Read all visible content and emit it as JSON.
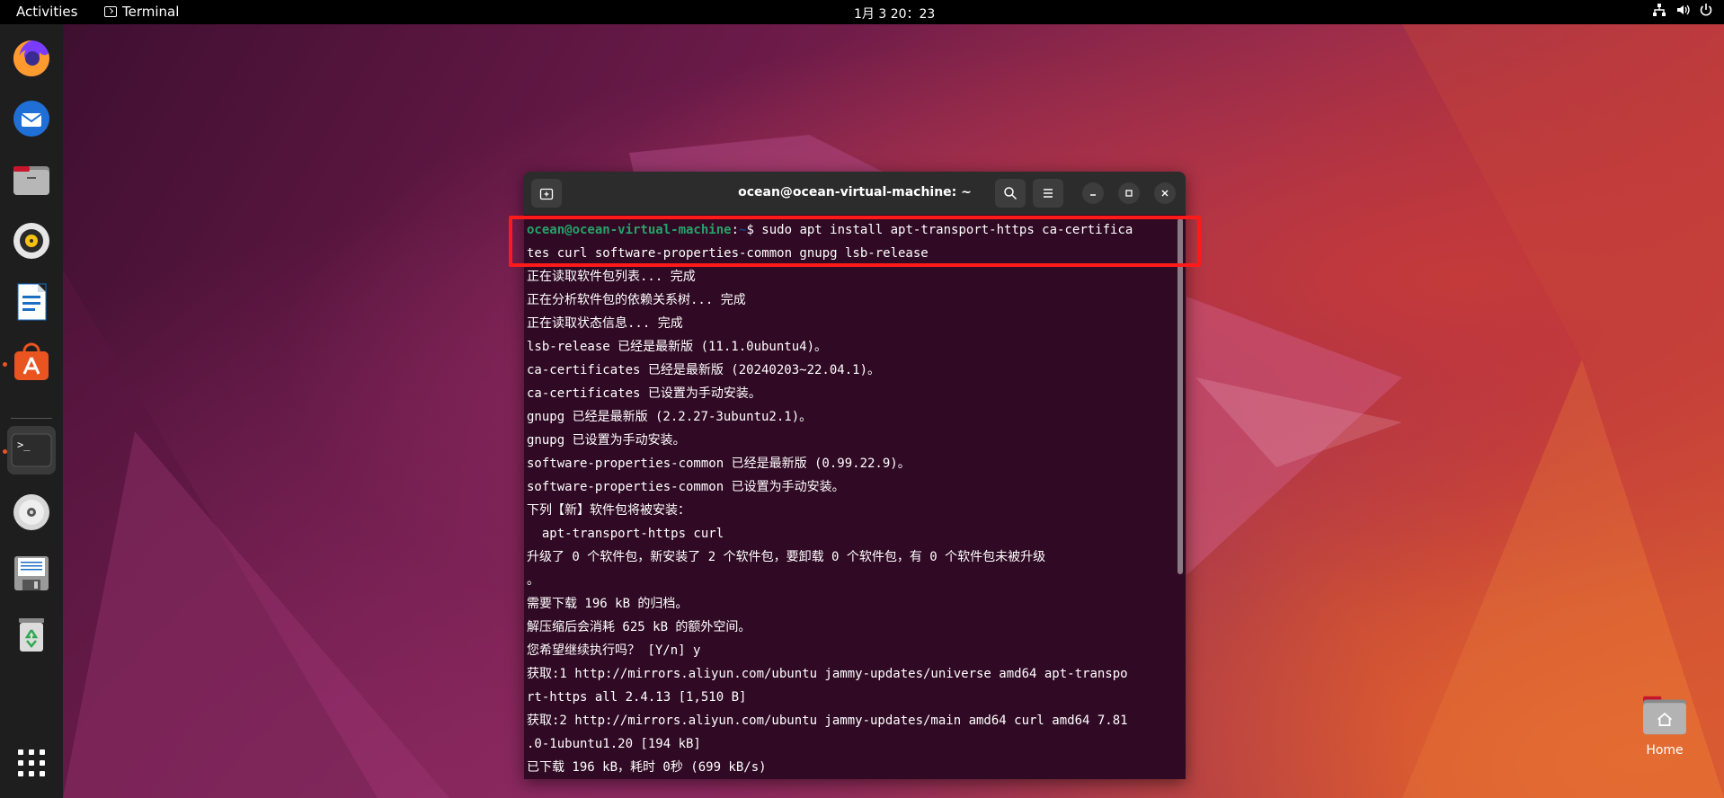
{
  "topbar": {
    "activities": "Activities",
    "app_name": "Terminal",
    "clock": "1月 3  20：23"
  },
  "dock": {
    "items": [
      {
        "name": "firefox-icon"
      },
      {
        "name": "thunderbird-icon"
      },
      {
        "name": "files-icon"
      },
      {
        "name": "rhythmbox-icon"
      },
      {
        "name": "libreoffice-writer-icon"
      },
      {
        "name": "app-center-icon"
      },
      {
        "name": "terminal-icon"
      },
      {
        "name": "disc-icon"
      },
      {
        "name": "floppy-save-icon"
      },
      {
        "name": "trash-icon"
      },
      {
        "name": "show-apps-icon"
      }
    ]
  },
  "terminal": {
    "title": "ocean@ocean-virtual-machine: ~",
    "prompt_user": "ocean@ocean-virtual-machine",
    "prompt_sep": ":",
    "prompt_path": "~",
    "prompt_cmd": "$ sudo apt install apt-transport-https ca-certifica",
    "lines": [
      "tes curl software-properties-common gnupg lsb-release",
      "正在读取软件包列表... 完成",
      "正在分析软件包的依赖关系树... 完成",
      "正在读取状态信息... 完成",
      "lsb-release 已经是最新版 (11.1.0ubuntu4)。",
      "ca-certificates 已经是最新版 (20240203~22.04.1)。",
      "ca-certificates 已设置为手动安装。",
      "gnupg 已经是最新版 (2.2.27-3ubuntu2.1)。",
      "gnupg 已设置为手动安装。",
      "software-properties-common 已经是最新版 (0.99.22.9)。",
      "software-properties-common 已设置为手动安装。",
      "下列【新】软件包将被安装：",
      "  apt-transport-https curl",
      "升级了 0 个软件包，新安装了 2 个软件包，要卸载 0 个软件包，有 0 个软件包未被升级",
      "。",
      "需要下载 196 kB 的归档。",
      "解压缩后会消耗 625 kB 的额外空间。",
      "您希望继续执行吗？ [Y/n] y",
      "获取:1 http://mirrors.aliyun.com/ubuntu jammy-updates/universe amd64 apt-transpo",
      "rt-https all 2.4.13 [1,510 B]",
      "获取:2 http://mirrors.aliyun.com/ubuntu jammy-updates/main amd64 curl amd64 7.81",
      ".0-1ubuntu1.20 [194 kB]",
      "已下载 196 kB，耗时 0秒 (699 kB/s)"
    ]
  },
  "desktop": {
    "home_label": "Home"
  },
  "colors": {
    "terminal_bg": "#300a24",
    "prompt_user": "#26a269",
    "prompt_path": "#12488b",
    "highlight": "#ff1a1a",
    "accent": "#e95420"
  }
}
